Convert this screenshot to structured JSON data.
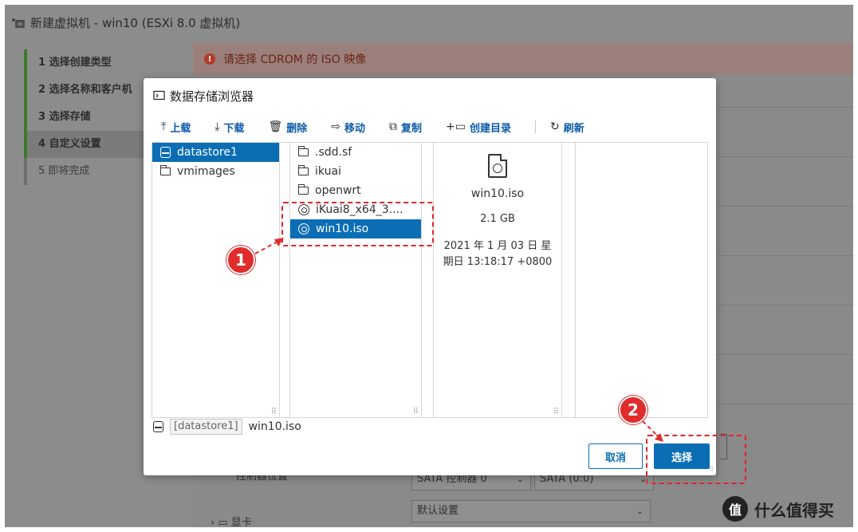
{
  "wizard": {
    "title": "新建虚拟机 - win10 (ESXi 8.0 虚拟机)",
    "steps": [
      {
        "label": "1  选择创建类型"
      },
      {
        "label": "2  选择名称和客户机"
      },
      {
        "label": "3  选择存储"
      },
      {
        "label": "4  自定义设置"
      },
      {
        "label": "5  即将完成"
      }
    ],
    "error": "请选择 CDROM 的 ISO 映像",
    "bg_select_1": "SATA 控制器 0",
    "bg_select_2": "SATA (0:0)",
    "bg_select_3": "默认设置",
    "bg_label_controller": "控制器位置",
    "bg_label_gpu": "显卡"
  },
  "dialog": {
    "title": "数据存储浏览器",
    "toolbar": {
      "upload": "上载",
      "download": "下载",
      "delete": "删除",
      "move": "移动",
      "copy": "复制",
      "mkdir": "创建目录",
      "refresh": "刷新"
    },
    "datastores": [
      "datastore1",
      "vmimages"
    ],
    "files": [
      ".sdd.sf",
      "ikuai",
      "openwrt",
      "iKuai8_x64_3....",
      "win10.iso"
    ],
    "preview": {
      "name": "win10.iso",
      "size": "2.1 GB",
      "date_line1": "2021 年 1 月 03 日 星",
      "date_line2": "期日 13:18:17 +0800"
    },
    "path_tag": "[datastore1]",
    "path_file": "win10.iso",
    "cancel": "取消",
    "select": "选择"
  },
  "annotations": {
    "badge1": "1",
    "badge2": "2"
  },
  "watermark": {
    "logo": "值",
    "text": "什么值得买"
  },
  "colors": {
    "accent": "#0b6eb5",
    "annotation": "#e12c2c"
  }
}
